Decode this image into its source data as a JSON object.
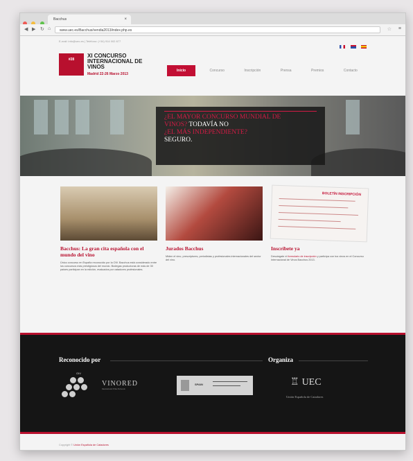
{
  "browser": {
    "tab_title": "Bacchus",
    "url": "www.uec.es/Bacchus/vendia2013/index.php.es",
    "traffic_colors": [
      "#ee5b55",
      "#f5bd3f",
      "#5fc34c"
    ]
  },
  "header": {
    "contact": "E-mail: info@uec.es | Teléfono: (+34) 914 002 877",
    "flags": [
      {
        "name": "fr",
        "color": "#2a4fa8"
      },
      {
        "name": "gb",
        "color": "#c8102e"
      },
      {
        "name": "es",
        "color": "#d8a600"
      }
    ],
    "logo_badge": "#28",
    "logo_title": "XI CONCURSO INTERNACIONAL DE VINOS",
    "logo_date": "Madrid 22-26 Marzo 2013",
    "nav": [
      "Inicio",
      "Concurso",
      "Inscripción",
      "Prensa",
      "Premios",
      "Contacto"
    ]
  },
  "hero": {
    "line1": "¿EL MAYOR CONCURSO MUNDIAL DE",
    "line2a": "VINOS?",
    "line2b": " TODAVÍA NO",
    "line3": "¿EL MÁS INDEPENDIENTE?",
    "line4": "SEGURO."
  },
  "columns": [
    {
      "title": "Bacchus: La gran cita española con el mundo del vino",
      "desc": "Único concurso en España reconocido por la OIV. Bacchus está considerado entre los concursos más prestigiosos del mundo. Bodegas productoras de más de 30 países participan en la edición, evaluados por catadores profesionales."
    },
    {
      "title": "Jurados Bacchus",
      "desc": "Miden el vino, prescriptores, periodistas y profesionales internacionales del sector del vino."
    },
    {
      "title": "Inscríbete ya",
      "desc_prefix": "Descárgate el ",
      "desc_link": "formulario de inscripción",
      "desc_suffix": " y participa con tus vinos en el Concurso Internacional de Vinos Bacchus 2013.",
      "form_head": "BOLETÍN INSCRIPCIÓN"
    }
  ],
  "footer": {
    "recognized_heading": "Reconocido por",
    "organized_heading": "Organiza",
    "oiv_label": "OIV",
    "vinored_label": "VINORED",
    "vinored_sub": "International Wine Network",
    "gov_label": "SPAIN",
    "uec_label": "UEC",
    "uec_name": "Unión Española de Catadores",
    "copyright_prefix": "Copyright © ",
    "copyright_link": "Unión Española de Catadores"
  }
}
